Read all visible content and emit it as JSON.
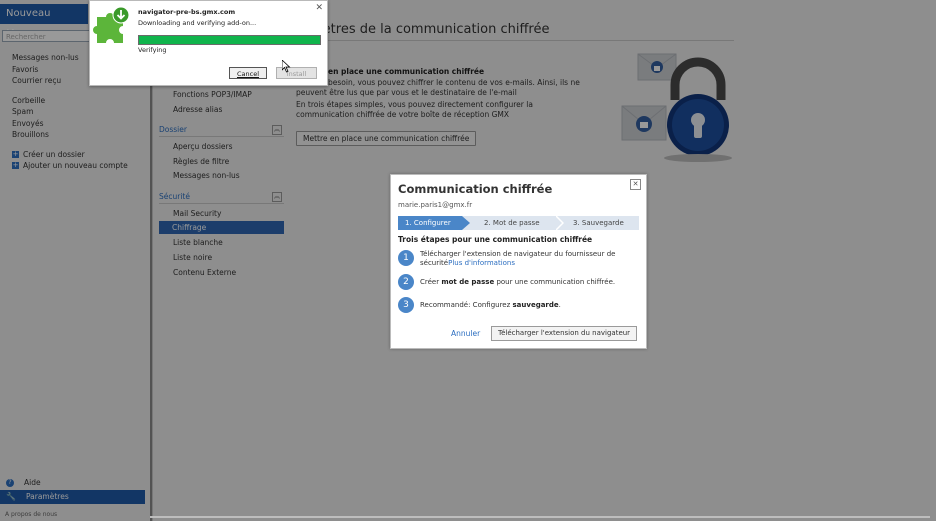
{
  "sidebar": {
    "new_message": "Nouveau Message",
    "search_placeholder": "Rechercher",
    "folders": [
      "Messages non-lus",
      "Favoris",
      "Courrier reçu",
      "Corbeille",
      "Spam",
      "Envoyés",
      "Brouillons"
    ],
    "create_folder": "Créer un dossier",
    "add_account": "Ajouter un nouveau compte",
    "help": "Aide",
    "settings": "Paramètres",
    "about": "A propos de nous"
  },
  "settings_nav": {
    "items_top": [
      "Fonctions POP3/IMAP",
      "Adresse alias"
    ],
    "section_dossier": "Dossier",
    "dossier_items": [
      "Aperçu dossiers",
      "Règles de filtre",
      "Messages non-lus"
    ],
    "section_securite": "Sécurité",
    "securite_items": [
      "Mail Security",
      "Chiffrage",
      "Liste blanche",
      "Liste noire",
      "Contenu Externe"
    ]
  },
  "main": {
    "title": "mètres de la communication chiffrée",
    "heading": "en place une communication chiffrée",
    "para1_line1": "besoin, vous pouvez chiffrer le contenu de vos e-mails. Ainsi, ils ne",
    "para1_line2": "peuvent être lus que par vous et le destinataire de l'e-mail",
    "para2": "En trois étapes simples, vous pouvez directement configurer la communication chiffrée de votre boîte de réception GMX",
    "setup_button": "Mettre en place une communication chiffrée"
  },
  "modal": {
    "title": "Communication chiffrée",
    "email": "marie.paris1@gmx.fr",
    "steps": [
      "1. Configurer",
      "2. Mot de passe",
      "3. Sauvegarde"
    ],
    "subheading": "Trois étapes pour une communication chiffrée",
    "items": [
      {
        "num": "1",
        "text": "Télécharger l'extension de navigateur du fournisseur de sécurité",
        "link": "Plus d'informations"
      },
      {
        "num": "2",
        "pre": "Créer ",
        "bold": "mot de passe",
        "post": " pour une communication chiffrée."
      },
      {
        "num": "3",
        "pre": "Recommandé: Configurez ",
        "bold": "sauvegarde",
        "post": "."
      }
    ],
    "cancel": "Annuler",
    "download": "Télécharger l'extension du navigateur",
    "accent": "#4a86c8"
  },
  "addon_popup": {
    "host": "navigator-pre-bs.gmx.com",
    "message": "Downloading and verifying add-on...",
    "status": "Verifying",
    "progress": 1.0,
    "cancel": "Cancel",
    "install": "Install",
    "progress_color": "#10b44c"
  }
}
